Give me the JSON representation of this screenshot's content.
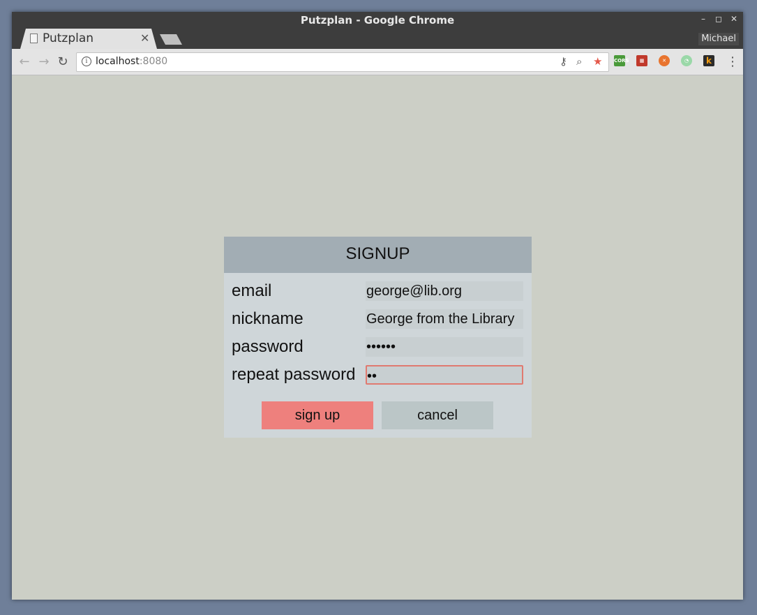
{
  "browser": {
    "window_title": "Putzplan - Google Chrome",
    "tab_title": "Putzplan",
    "profile_name": "Michael",
    "url_host": "localhost",
    "url_port": ":8080"
  },
  "signup": {
    "title": "SIGNUP",
    "fields": [
      {
        "label": "email",
        "value": "george@lib.org"
      },
      {
        "label": "nickname",
        "value": "George from the Library"
      },
      {
        "label": "password",
        "value": "••••••"
      },
      {
        "label": "repeat password",
        "value": "••"
      }
    ],
    "signup_label": "sign up",
    "cancel_label": "cancel"
  },
  "colors": {
    "signup_button": "#ee807d",
    "cancel_button": "#bbc6c7",
    "dialog_header": "#a2adb4",
    "dialog_body": "#cfd6d9",
    "page_background": "#cccfc6",
    "focus_border": "#e07a70"
  }
}
